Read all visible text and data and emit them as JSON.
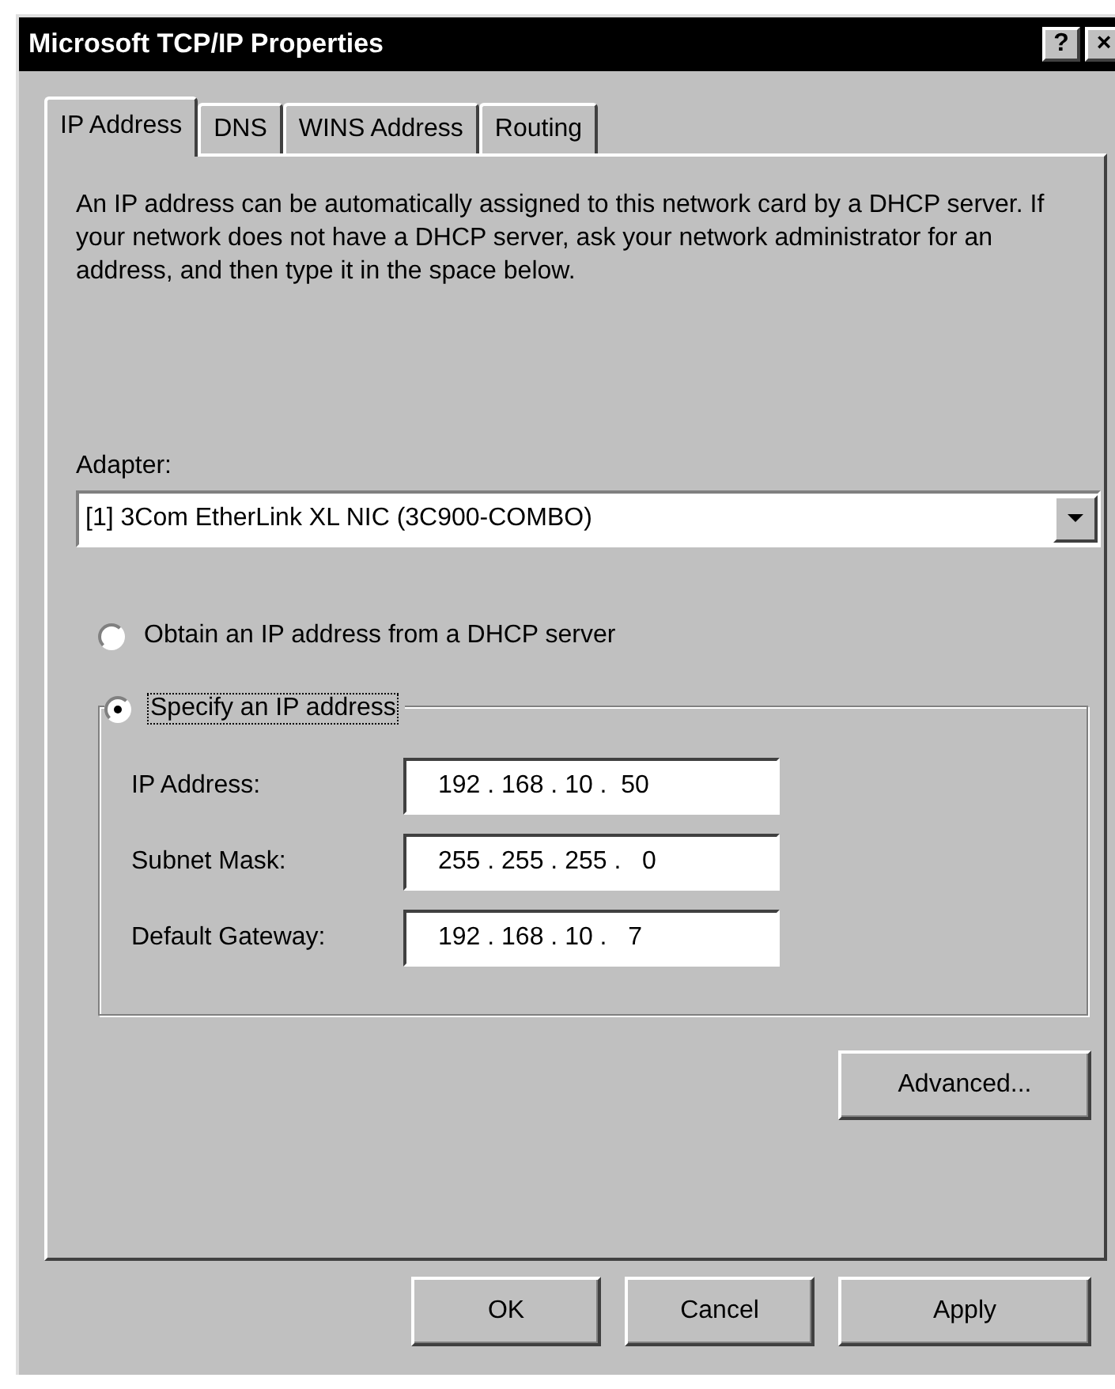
{
  "window": {
    "title": "Microsoft TCP/IP Properties",
    "help_button": "?",
    "close_button": "×"
  },
  "tabs": [
    {
      "label": "IP Address",
      "selected": true
    },
    {
      "label": "DNS",
      "selected": false
    },
    {
      "label": "WINS Address",
      "selected": false
    },
    {
      "label": "Routing",
      "selected": false
    }
  ],
  "description": "An IP address can be automatically assigned to this network card by a DHCP server.  If your network does not have a DHCP server, ask your network administrator for an address, and then type it in the space below.",
  "adapter": {
    "label": "Adapter:",
    "value": "[1] 3Com EtherLink XL NIC (3C900-COMBO)"
  },
  "options": [
    {
      "label": "Obtain an IP address from a DHCP server",
      "selected": false
    },
    {
      "label": "Specify an IP address",
      "selected": true
    }
  ],
  "fields": [
    {
      "label": "IP Address:",
      "value": "192 . 168 . 10 .  50"
    },
    {
      "label": "Subnet Mask:",
      "value": "255 . 255 . 255 .   0"
    },
    {
      "label": "Default Gateway:",
      "value": "192 . 168 . 10 .   7"
    }
  ],
  "advanced_button": "Advanced...",
  "buttons": [
    "OK",
    "Cancel",
    "Apply"
  ]
}
